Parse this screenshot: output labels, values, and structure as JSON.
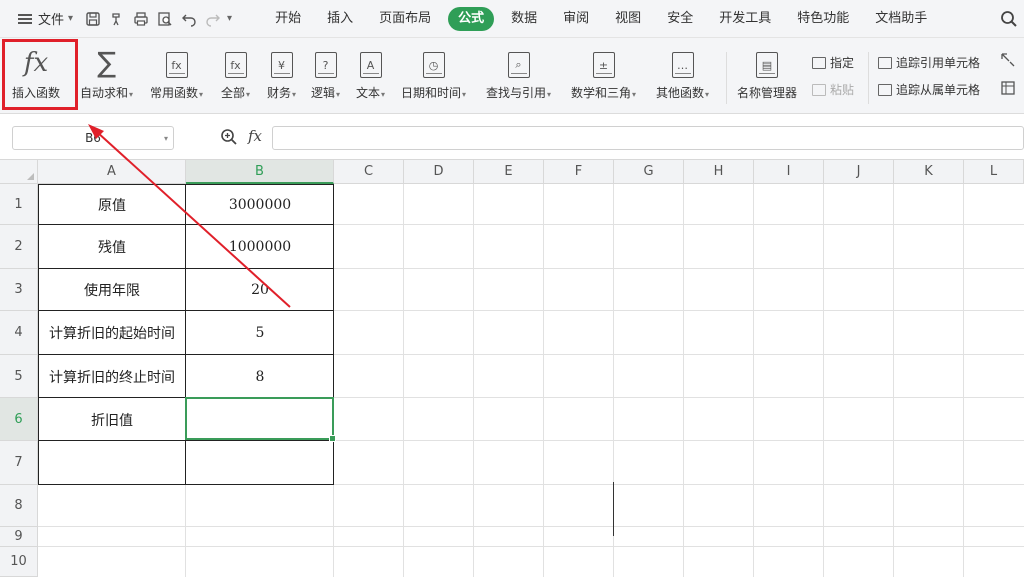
{
  "menubar": {
    "file_label": "文件",
    "tabs": [
      {
        "label": "开始",
        "active": false
      },
      {
        "label": "插入",
        "active": false
      },
      {
        "label": "页面布局",
        "active": false
      },
      {
        "label": "公式",
        "active": true
      },
      {
        "label": "数据",
        "active": false
      },
      {
        "label": "审阅",
        "active": false
      },
      {
        "label": "视图",
        "active": false
      },
      {
        "label": "安全",
        "active": false
      },
      {
        "label": "开发工具",
        "active": false
      },
      {
        "label": "特色功能",
        "active": false
      },
      {
        "label": "文档助手",
        "active": false
      }
    ]
  },
  "ribbon": {
    "insert_function": "插入函数",
    "autosum": "自动求和",
    "common_functions": "常用函数",
    "all": "全部",
    "finance": "财务",
    "logic": "逻辑",
    "text": "文本",
    "datetime": "日期和时间",
    "lookup": "查找与引用",
    "math": "数学和三角",
    "other": "其他函数",
    "name_manager": "名称管理器",
    "define": "指定",
    "paste": "粘贴",
    "trace_precedents": "追踪引用单元格",
    "trace_dependents": "追踪从属单元格",
    "icon_glyphs": {
      "finance": "¥",
      "logic": "?",
      "text": "A",
      "all": "fx"
    }
  },
  "formula_bar": {
    "name_box": "B6",
    "fx_label": "fx",
    "content": ""
  },
  "grid": {
    "columns": [
      "A",
      "B",
      "C",
      "D",
      "E",
      "F",
      "G",
      "H",
      "I",
      "J",
      "K",
      "L"
    ],
    "rows": [
      "1",
      "2",
      "3",
      "4",
      "5",
      "6",
      "7",
      "8",
      "9",
      "10"
    ],
    "selected_cell": "B6",
    "cells": {
      "A1": "原值",
      "B1": "3000000",
      "A2": "残值",
      "B2": "1000000",
      "A3": "使用年限",
      "B3": "20",
      "A4": "计算折旧的起始时间",
      "B4": "5",
      "A5": "计算折旧的终止时间",
      "B5": "8",
      "A6": "折旧值",
      "B6": ""
    }
  },
  "colors": {
    "accent": "#2f9e57",
    "annotation": "#e0202a"
  }
}
